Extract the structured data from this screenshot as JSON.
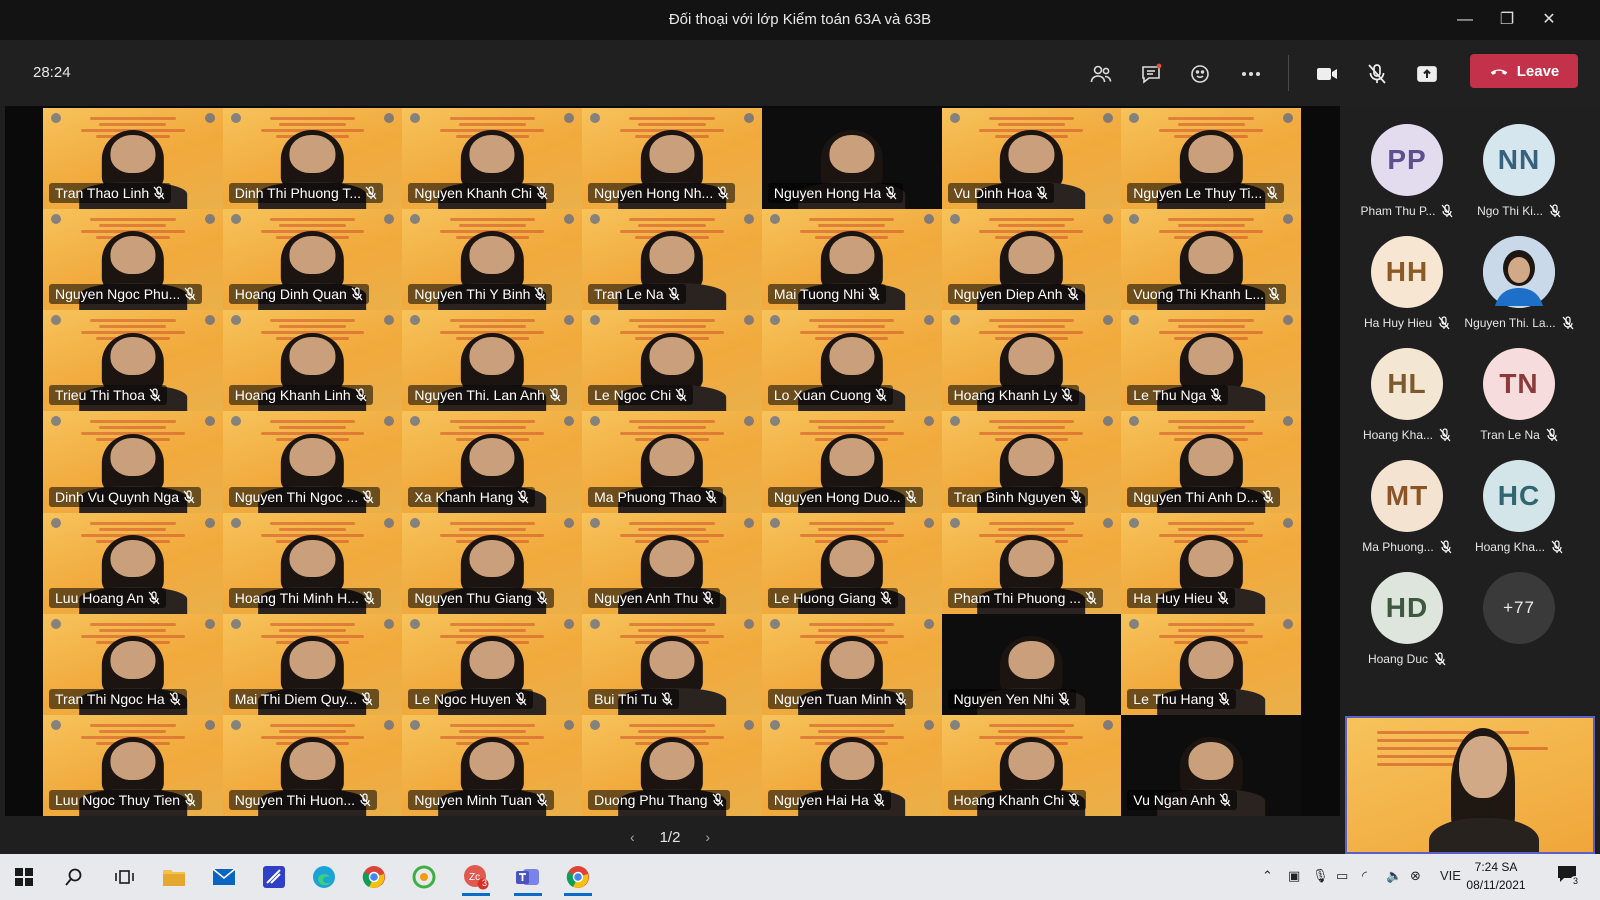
{
  "window": {
    "title": "Đối thoại với lớp Kiểm toán 63A và 63B",
    "minimize": "—",
    "restore": "❐",
    "close": "✕"
  },
  "toolbar": {
    "timer": "28:24",
    "leave_label": "Leave",
    "leave_color": "#c4314b"
  },
  "grid": {
    "tiles": [
      {
        "name": "Tran Thao Linh",
        "dark": false
      },
      {
        "name": "Dinh Thi Phuong T...",
        "dark": false
      },
      {
        "name": "Nguyen Khanh Chi",
        "dark": false
      },
      {
        "name": "Nguyen Hong Nh...",
        "dark": false
      },
      {
        "name": "Nguyen Hong Ha",
        "dark": true
      },
      {
        "name": "Vu Dinh Hoa",
        "dark": false
      },
      {
        "name": "Nguyen Le Thuy Ti...",
        "dark": false
      },
      {
        "name": "Nguyen Ngoc Phu...",
        "dark": false
      },
      {
        "name": "Hoang Dinh Quan",
        "dark": false
      },
      {
        "name": "Nguyen Thi Y Binh",
        "dark": false
      },
      {
        "name": "Tran Le Na",
        "dark": false
      },
      {
        "name": "Mai Tuong Nhi",
        "dark": false
      },
      {
        "name": "Nguyen Diep Anh",
        "dark": false
      },
      {
        "name": "Vuong Thi Khanh L...",
        "dark": false
      },
      {
        "name": "Trieu Thi Thoa",
        "dark": false
      },
      {
        "name": "Hoang Khanh Linh",
        "dark": false
      },
      {
        "name": "Nguyen Thi. Lan Anh",
        "dark": false
      },
      {
        "name": "Le Ngoc Chi",
        "dark": false
      },
      {
        "name": "Lo Xuan Cuong",
        "dark": false
      },
      {
        "name": "Hoang Khanh Ly",
        "dark": false
      },
      {
        "name": "Le Thu Nga",
        "dark": false
      },
      {
        "name": "Dinh Vu Quynh Nga",
        "dark": false
      },
      {
        "name": "Nguyen Thi Ngoc ...",
        "dark": false
      },
      {
        "name": "Xa Khanh Hang",
        "dark": false
      },
      {
        "name": "Ma Phuong Thao",
        "dark": false
      },
      {
        "name": "Nguyen Hong Duo...",
        "dark": false
      },
      {
        "name": "Tran Binh Nguyen",
        "dark": false
      },
      {
        "name": "Nguyen Thi Anh D...",
        "dark": false
      },
      {
        "name": "Luu Hoang An",
        "dark": false
      },
      {
        "name": "Hoang Thi Minh H...",
        "dark": false
      },
      {
        "name": "Nguyen Thu Giang",
        "dark": false
      },
      {
        "name": "Nguyen Anh Thu",
        "dark": false
      },
      {
        "name": "Le Huong Giang",
        "dark": false
      },
      {
        "name": "Pham Thi Phuong ...",
        "dark": false
      },
      {
        "name": "Ha Huy Hieu",
        "dark": false
      },
      {
        "name": "Tran Thi Ngoc Ha",
        "dark": false
      },
      {
        "name": "Mai Thi Diem Quy...",
        "dark": false
      },
      {
        "name": "Le Ngoc Huyen",
        "dark": false
      },
      {
        "name": "Bui Thi Tu",
        "dark": false
      },
      {
        "name": "Nguyen Tuan Minh",
        "dark": false
      },
      {
        "name": "Nguyen Yen Nhi",
        "dark": true
      },
      {
        "name": "Le Thu Hang",
        "dark": false
      },
      {
        "name": "Luu Ngoc Thuy Tien",
        "dark": false
      },
      {
        "name": "Nguyen Thi Huon...",
        "dark": false
      },
      {
        "name": "Nguyen Minh Tuan",
        "dark": false
      },
      {
        "name": "Duong Phu Thang",
        "dark": false
      },
      {
        "name": "Nguyen Hai Ha",
        "dark": false
      },
      {
        "name": "Hoang Khanh Chi",
        "dark": false
      },
      {
        "name": "Vu Ngan Anh",
        "dark": true
      }
    ]
  },
  "pager": {
    "label": "1/2",
    "prev": "‹",
    "next": "›"
  },
  "rail": {
    "participants": [
      {
        "initials": "PP",
        "name": "Pham Thu P...",
        "bg": "#e3dcef",
        "fg": "#5f4f8c"
      },
      {
        "initials": "NN",
        "name": "Ngo Thi Ki...",
        "bg": "#d6e6ef",
        "fg": "#36627c"
      },
      {
        "initials": "HH",
        "name": "Ha Huy Hieu",
        "bg": "#f7e6d2",
        "fg": "#8b5a25"
      },
      {
        "initials": "",
        "name": "Nguyen Thi. La...",
        "bg": "#c9d9ea",
        "fg": "#2b4f78",
        "photo": true
      },
      {
        "initials": "HL",
        "name": "Hoang Kha...",
        "bg": "#f3e6d2",
        "fg": "#7d5a2d"
      },
      {
        "initials": "TN",
        "name": "Tran Le Na",
        "bg": "#f6dcdc",
        "fg": "#8b3a3a"
      },
      {
        "initials": "MT",
        "name": "Ma Phuong...",
        "bg": "#f5e3d2",
        "fg": "#8a5427"
      },
      {
        "initials": "HC",
        "name": "Hoang Kha...",
        "bg": "#d3e5e8",
        "fg": "#2f6670"
      },
      {
        "initials": "HD",
        "name": "Hoang Duc",
        "bg": "#dde5dd",
        "fg": "#3e5a3e"
      }
    ],
    "overflow": "+77"
  },
  "taskbar": {
    "lang": "VIE",
    "time": "7:24 SA",
    "date": "08/11/2021",
    "notification_count": "3",
    "zalo_badge": "3"
  }
}
